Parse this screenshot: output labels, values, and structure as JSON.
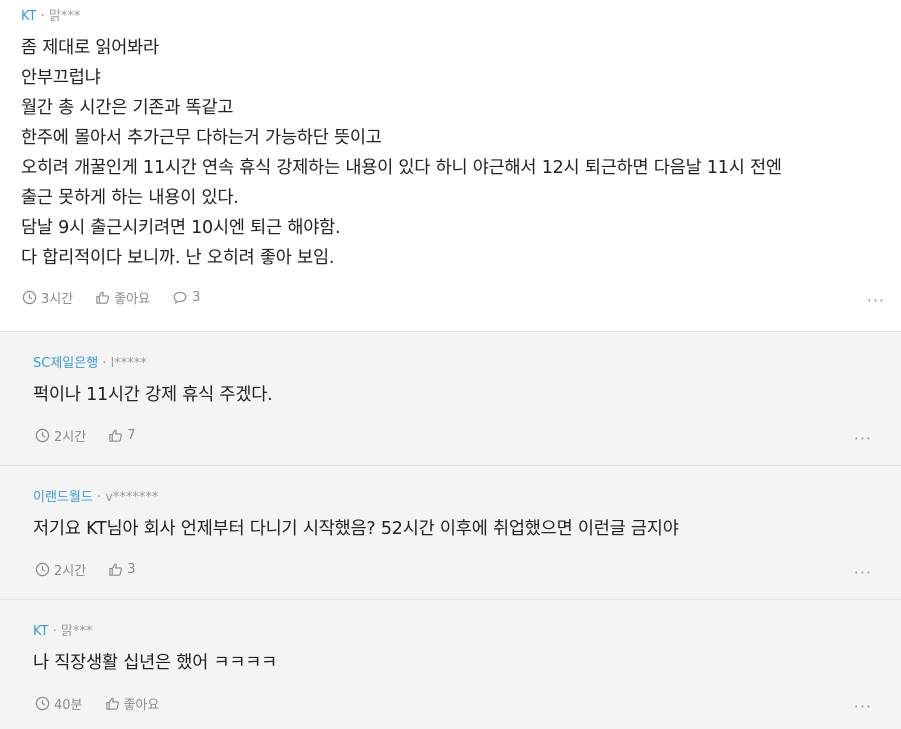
{
  "main_comment": {
    "company": "KT",
    "author": "맑***",
    "lines": [
      "좀 제대로 읽어봐라",
      "안부끄럽냐",
      "월간 총 시간은 기존과 똑같고",
      "한주에 몰아서 추가근무 다하는거 가능하단 뜻이고",
      "오히려 개꿀인게 11시간 연속 휴식 강제하는 내용이 있다 하니 야근해서 12시 퇴근하면 다음날 11시 전엔",
      "출근 못하게 하는 내용이 있다.",
      "담날 9시 출근시키려면 10시엔 퇴근 해야함.",
      "다 합리적이다 보니까. 난 오히려 좋아 보임."
    ],
    "time": "3시간",
    "like_label": "좋아요",
    "reply_count": "3"
  },
  "replies": [
    {
      "company": "SC제일은행",
      "author": "l*****",
      "text": "퍽이나 11시간 강제 휴식 주겠다.",
      "time": "2시간",
      "likes": "7"
    },
    {
      "company": "이랜드월드",
      "author": "v*******",
      "text": "저기요 KT님아 회사 언제부터 다니기 시작했음? 52시간 이후에 취업했으면 이런글 금지야",
      "time": "2시간",
      "likes": "3"
    },
    {
      "company": "KT",
      "author": "맑***",
      "text": "나 직장생활 십년은 했어 ㅋㅋㅋㅋ",
      "time": "40분",
      "likes": "좋아요"
    }
  ],
  "separator": " · ",
  "more_label": "···",
  "icons": {
    "clock": "clock-icon",
    "thumb": "thumbs-up-icon",
    "speech": "speech-bubble-icon",
    "more": "more-dots-icon"
  },
  "colors": {
    "company_link": "#3b9bd1",
    "meta_gray": "#9a9a9a",
    "reply_background": "#f4f4f4"
  }
}
